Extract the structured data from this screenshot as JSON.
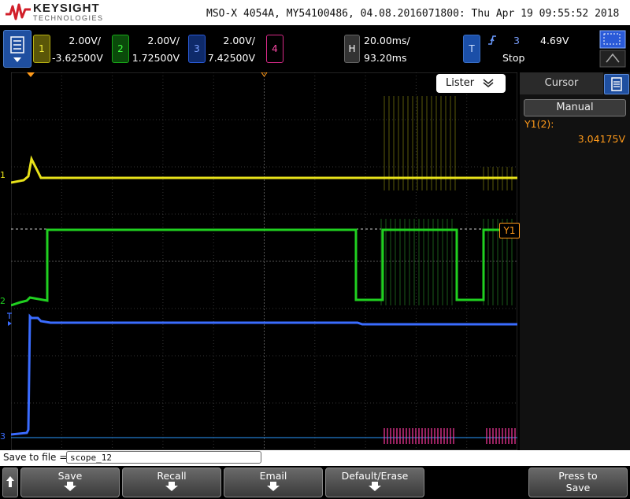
{
  "header": {
    "brand": "KEYSIGHT",
    "brand_sub": "TECHNOLOGIES",
    "title": "MSO-X 4054A, MY54100486, 04.08.2016071800: Thu Apr 19 09:55:52 2018"
  },
  "channels": [
    {
      "num": "1",
      "scale": "2.00V/",
      "offset": "-3.62500V",
      "color": "#e8e21a"
    },
    {
      "num": "2",
      "scale": "2.00V/",
      "offset": "1.72500V",
      "color": "#20d020"
    },
    {
      "num": "3",
      "scale": "2.00V/",
      "offset": "7.42500V",
      "color": "#3a6cff"
    },
    {
      "num": "4",
      "color": "#ff3aa0"
    }
  ],
  "horizontal": {
    "label": "H",
    "timebase": "20.00ms/",
    "delay": "93.20ms"
  },
  "trigger": {
    "label": "T",
    "source": "3",
    "level": "4.69V",
    "state": "Stop"
  },
  "listener": {
    "label": "Lister"
  },
  "cursor_panel": {
    "title": "Cursor",
    "mode": "Manual",
    "y1_label": "Y1(2):",
    "y1_value": "3.04175V"
  },
  "markers": {
    "y1": "Y1",
    "ch1": "1",
    "ch2": "2",
    "ch3": "3"
  },
  "save": {
    "label": "Save to file =",
    "filename": "scope_12"
  },
  "softkeys": {
    "save": "Save",
    "recall": "Recall",
    "email": "Email",
    "default_erase": "Default/Erase",
    "press_to": "Press to",
    "press_save": "Save"
  },
  "icons": {
    "menu": "menu-icon",
    "touch": "touch-select-icon",
    "cursor": "cursor-icon",
    "back": "up-arrow-icon"
  }
}
